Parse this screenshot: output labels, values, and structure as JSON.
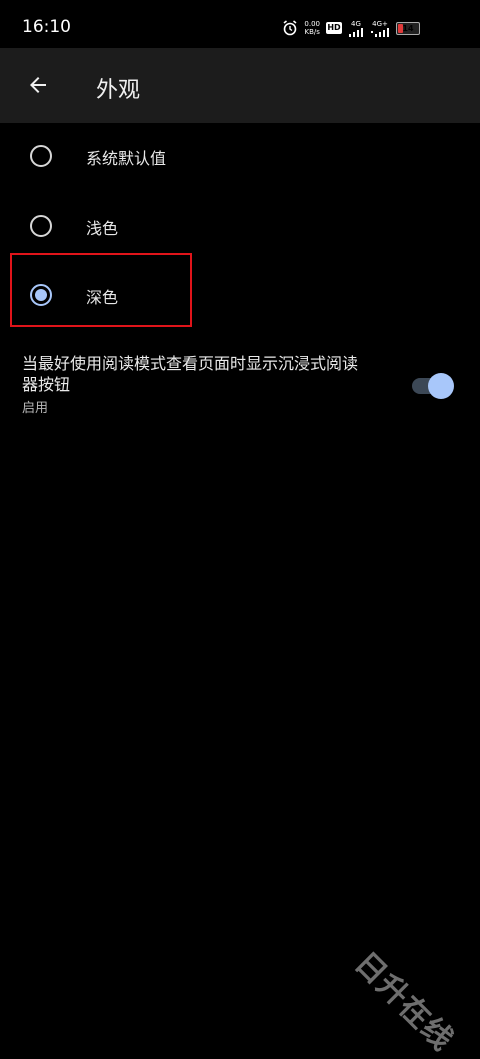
{
  "status_bar": {
    "time": "16:10",
    "net_speed_value": "0.00",
    "net_speed_unit": "KB/s",
    "hd_badge": "HD",
    "sim1_label": "4G",
    "sim2_label": "4G+",
    "battery_level": "14"
  },
  "app_bar": {
    "title": "外观"
  },
  "options": [
    {
      "label": "系统默认值",
      "checked": false
    },
    {
      "label": "浅色",
      "checked": false
    },
    {
      "label": "深色",
      "checked": true
    }
  ],
  "reader_setting": {
    "title": "当最好使用阅读模式查看页面时显示沉浸式阅读器按钮",
    "subtitle": "启用",
    "enabled": true
  },
  "watermark": "日升在线",
  "colors": {
    "background": "#000000",
    "app_bar": "#1c1c1c",
    "accent": "#a8c7fa",
    "highlight": "#e0141a"
  }
}
